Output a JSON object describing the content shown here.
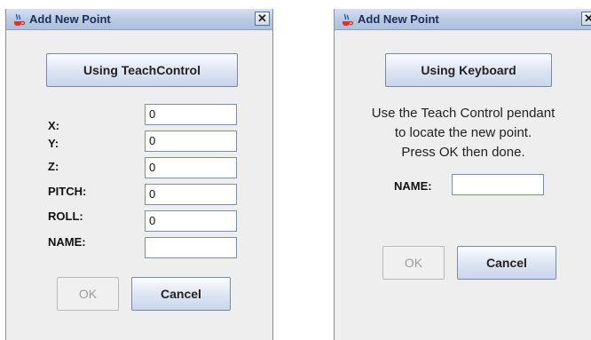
{
  "dialogs": [
    {
      "title": "Add New Point",
      "close_glyph": "✕",
      "mode_button": "Using TeachControl",
      "fields": [
        {
          "label": "X:",
          "value": "0"
        },
        {
          "label": "Y:",
          "value": "0"
        },
        {
          "label": "Z:",
          "value": "0"
        },
        {
          "label": "PITCH:",
          "value": "0"
        },
        {
          "label": "ROLL:",
          "value": "0"
        },
        {
          "label": "NAME:",
          "value": ""
        }
      ],
      "ok_label": "OK",
      "cancel_label": "Cancel"
    },
    {
      "title": "Add New Point",
      "close_glyph": "✕",
      "mode_button": "Using Keyboard",
      "message": [
        "Use the Teach Control pendant",
        "to locate the new point.",
        "Press OK then done."
      ],
      "name_label": "NAME:",
      "name_value": "",
      "ok_label": "OK",
      "cancel_label": "Cancel"
    }
  ],
  "icons": {
    "title_icon": "java-coffee-cup-icon",
    "close_icon": "close-icon"
  },
  "colors": {
    "title_bar": "#b8c9e2",
    "dialog_bg": "#eeeeee",
    "button_face": "#dde6f3",
    "disabled_text": "#9c9c9c"
  }
}
